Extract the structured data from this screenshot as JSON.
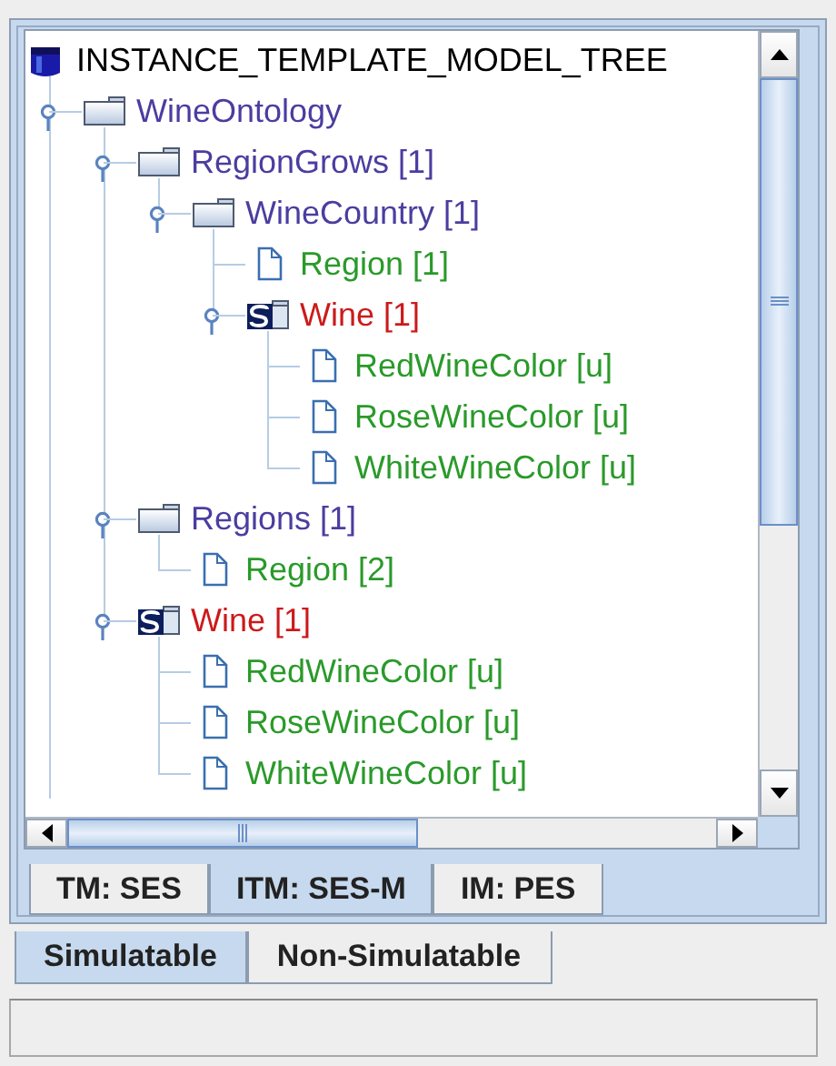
{
  "tree": {
    "label": "INSTANCE_TEMPLATE_MODEL_TREE",
    "kind": "root",
    "children": [
      {
        "label": "WineOntology",
        "kind": "folder",
        "expanded": true,
        "children": [
          {
            "label": "RegionGrows [1]",
            "kind": "folder",
            "expanded": true,
            "children": [
              {
                "label": "WineCountry [1]",
                "kind": "folder",
                "expanded": true,
                "children": [
                  {
                    "label": "Region [1]",
                    "kind": "leaf"
                  },
                  {
                    "label": "Wine [1]",
                    "kind": "class",
                    "expanded": true,
                    "children": [
                      {
                        "label": "RedWineColor [u]",
                        "kind": "leaf"
                      },
                      {
                        "label": "RoseWineColor [u]",
                        "kind": "leaf"
                      },
                      {
                        "label": "WhiteWineColor [u]",
                        "kind": "leaf"
                      }
                    ]
                  }
                ]
              }
            ]
          },
          {
            "label": "Regions [1]",
            "kind": "folder",
            "expanded": true,
            "children": [
              {
                "label": "Region [2]",
                "kind": "leaf"
              }
            ]
          },
          {
            "label": "Wine [1]",
            "kind": "class",
            "expanded": true,
            "children": [
              {
                "label": "RedWineColor [u]",
                "kind": "leaf"
              },
              {
                "label": "RoseWineColor [u]",
                "kind": "leaf"
              },
              {
                "label": "WhiteWineColor [u]",
                "kind": "leaf"
              }
            ]
          }
        ]
      }
    ]
  },
  "inner_tabs": [
    {
      "label": "TM: SES",
      "selected": false
    },
    {
      "label": "ITM: SES-M",
      "selected": true
    },
    {
      "label": "IM: PES",
      "selected": false
    }
  ],
  "outer_tabs": [
    {
      "label": "Simulatable",
      "selected": true
    },
    {
      "label": "Non-Simulatable",
      "selected": false
    }
  ]
}
